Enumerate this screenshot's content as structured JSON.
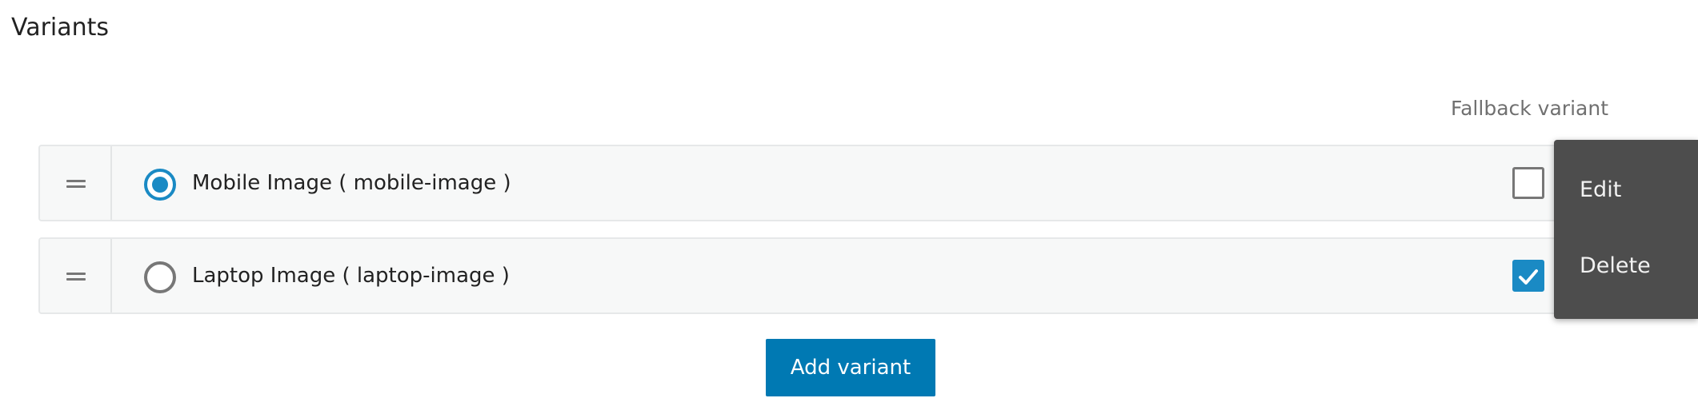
{
  "section": {
    "title": "Variants",
    "fallback_header": "Fallback variant"
  },
  "variants": [
    {
      "label": "Mobile Image ( mobile-image )",
      "selected": true,
      "fallback": false
    },
    {
      "label": "Laptop Image ( laptop-image )",
      "selected": false,
      "fallback": true
    }
  ],
  "context_menu": {
    "edit_label": "Edit",
    "delete_label": "Delete"
  },
  "actions": {
    "add_variant_label": "Add variant"
  },
  "colors": {
    "accent": "#1a8ac4",
    "button": "#0079b3",
    "menu_background": "#4d4d4d"
  }
}
